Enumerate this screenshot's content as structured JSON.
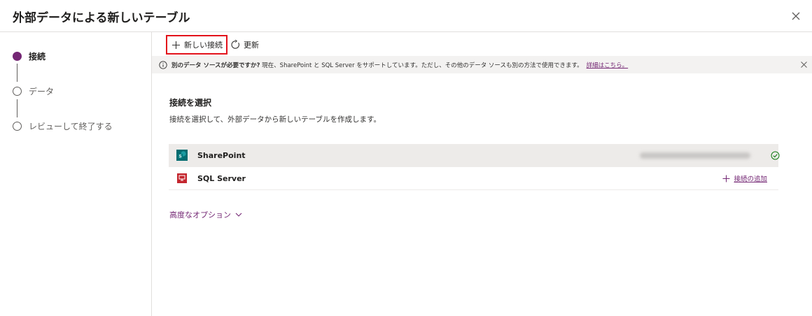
{
  "dialog": {
    "title": "外部データによる新しいテーブル"
  },
  "steps": [
    {
      "label": "接続",
      "state": "active"
    },
    {
      "label": "データ",
      "state": "pending"
    },
    {
      "label": "レビューして終了する",
      "state": "pending"
    }
  ],
  "toolbar": {
    "new_connection_label": "新しい接続",
    "refresh_label": "更新"
  },
  "banner": {
    "bold_text": "別のデータ ソースが必要ですか?",
    "text": "現在、SharePoint と SQL Server をサポートしています。ただし、その他のデータ ソースも別の方法で使用できます。",
    "link_text": "詳細はこちら。"
  },
  "section": {
    "title": "接続を選択",
    "description": "接続を選択して、外部データから新しいテーブルを作成します。"
  },
  "connections": [
    {
      "name": "SharePoint",
      "icon": "sharepoint-icon",
      "status": "connected"
    },
    {
      "name": "SQL Server",
      "icon": "sql-server-icon",
      "action_label": "接続の追加"
    }
  ],
  "advanced_options_label": "高度なオプション",
  "colors": {
    "accent": "#742774",
    "highlight_border": "#e3101a",
    "sharepoint": "#036c70",
    "sql_server": "#c4262e",
    "connected_check": "#107c10"
  }
}
